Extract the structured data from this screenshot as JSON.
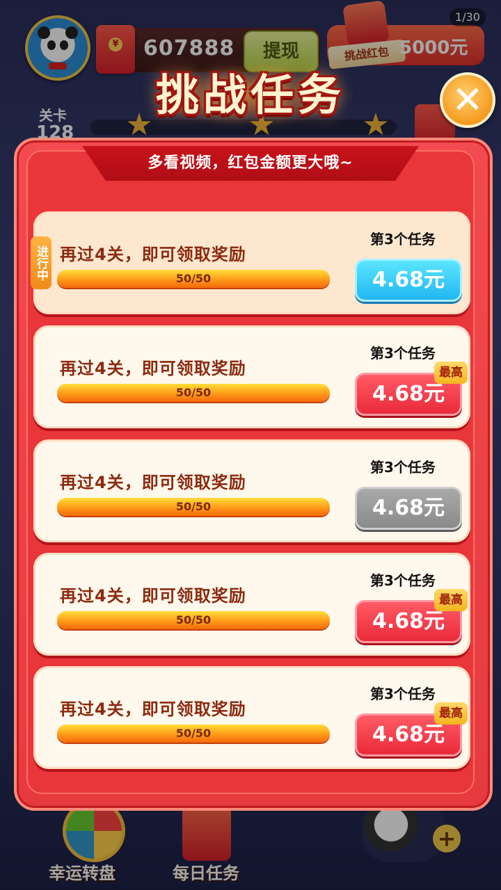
{
  "header": {
    "cash_amount": "607888",
    "withdraw_label": "提现",
    "challenge_counter": "1/30",
    "challenge_label": "挑战红包",
    "challenge_amount": "5000元",
    "level_label": "关卡",
    "level_number": "128"
  },
  "dialog": {
    "title": "挑战任务",
    "subtitle": "多看视频，红包金额更大哦~",
    "progress_tag": "进行中",
    "tasks": [
      {
        "text": "再过4关，即可领取奖励",
        "progress": "50/50",
        "index_label": "第3个任务",
        "reward": "4.68元",
        "state": "active",
        "badge": ""
      },
      {
        "text": "再过4关，即可领取奖励",
        "progress": "50/50",
        "index_label": "第3个任务",
        "reward": "4.68元",
        "state": "red",
        "badge": "最高"
      },
      {
        "text": "再过4关，即可领取奖励",
        "progress": "50/50",
        "index_label": "第3个任务",
        "reward": "4.68元",
        "state": "gray",
        "badge": ""
      },
      {
        "text": "再过4关，即可领取奖励",
        "progress": "50/50",
        "index_label": "第3个任务",
        "reward": "4.68元",
        "state": "red",
        "badge": "最高"
      },
      {
        "text": "再过4关，即可领取奖励",
        "progress": "50/50",
        "index_label": "第3个任务",
        "reward": "4.68元",
        "state": "red",
        "badge": "最高"
      }
    ]
  },
  "bottom_nav": {
    "lucky_wheel": "幸运转盘",
    "daily_tasks": "每日任务"
  },
  "colors": {
    "accent_red": "#e8363b",
    "reward_blue": "#21b6f2",
    "reward_red": "#ea2a3a",
    "reward_gray": "#8a8a8a",
    "progress_orange": "#ff9a18"
  }
}
